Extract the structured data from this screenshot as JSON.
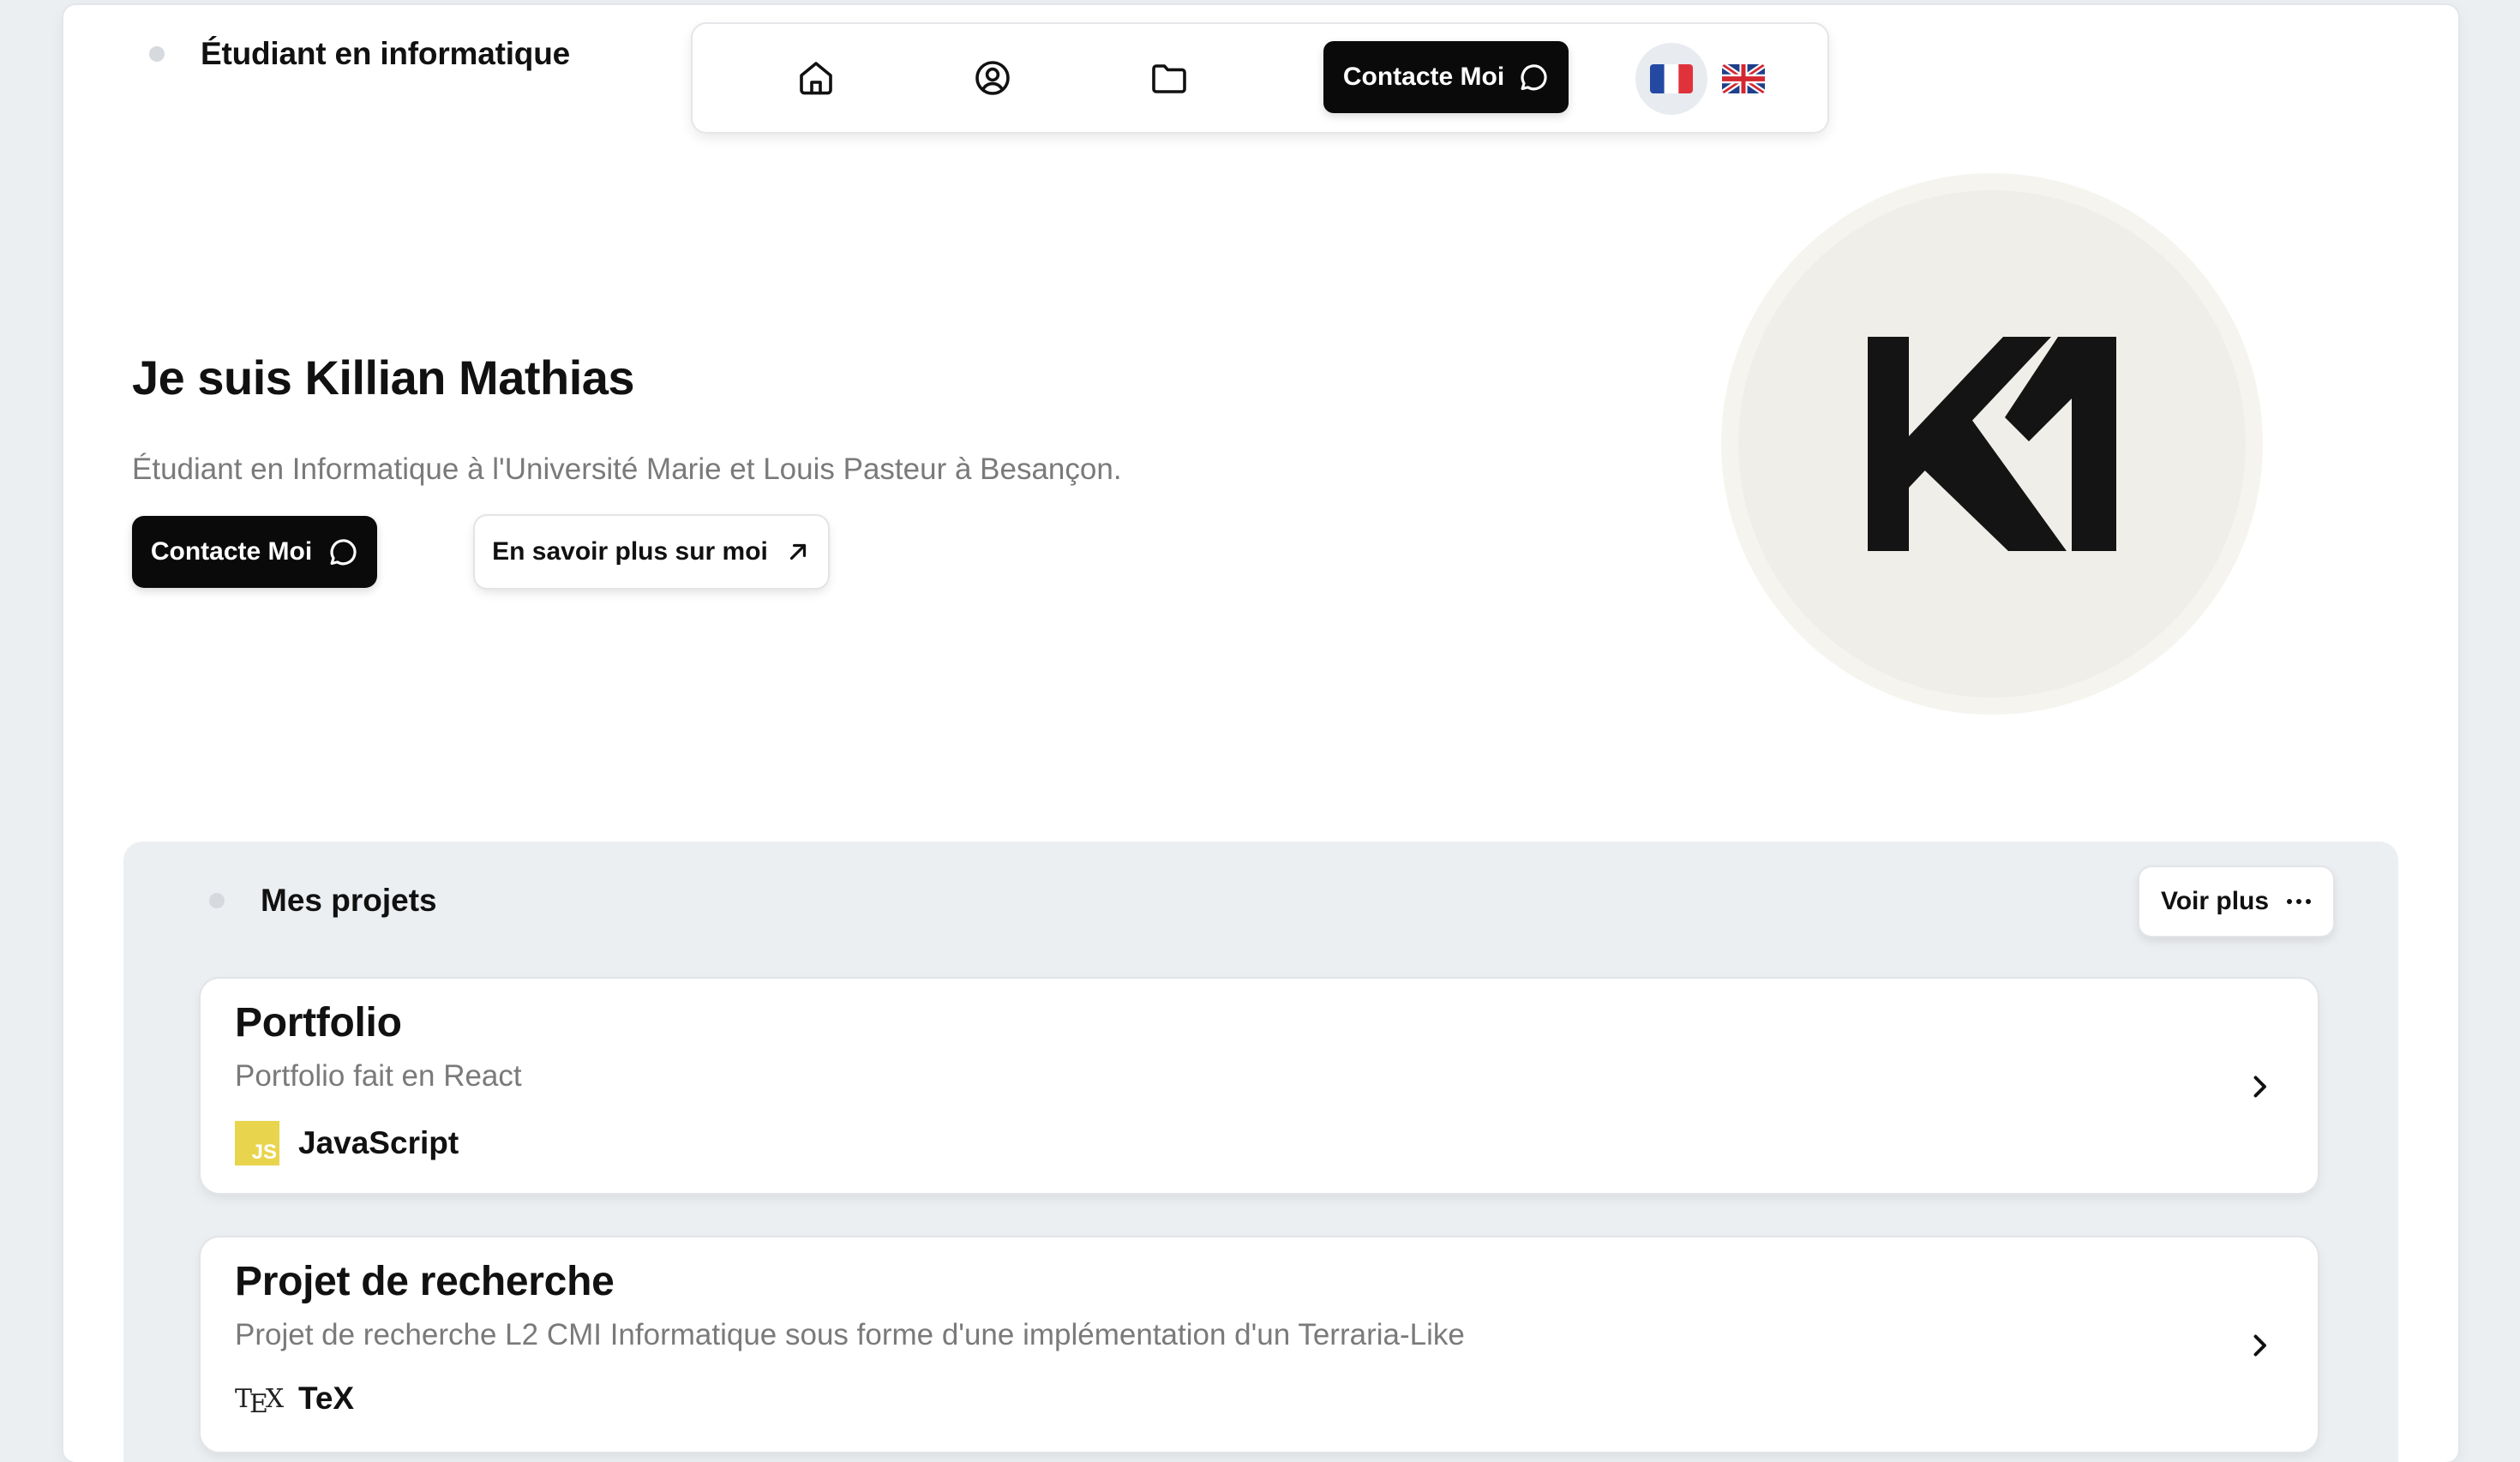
{
  "header": {
    "status_label": "Étudiant en informatique"
  },
  "navbar": {
    "icons": [
      "home-icon",
      "user-circle-icon",
      "folder-icon"
    ],
    "contact_label": "Contacte Moi",
    "languages": [
      {
        "code": "fr",
        "name": "French flag",
        "active": true
      },
      {
        "code": "en",
        "name": "UK flag",
        "active": false
      }
    ]
  },
  "hero": {
    "title": "Je suis Killian Mathias",
    "subtitle": "Étudiant en Informatique à l'Université Marie et Louis Pasteur à Besançon.",
    "contact_button": "Contacte Moi",
    "about_button": "En savoir plus sur moi",
    "logo_text": "KM"
  },
  "projects": {
    "section_label": "Mes projets",
    "more_button": "Voir plus",
    "items": [
      {
        "title": "Portfolio",
        "description": "Portfolio fait en React",
        "tech": "JavaScript",
        "tech_icon": "JS"
      },
      {
        "title": "Projet de recherche",
        "description": "Projet de recherche L2 CMI Informatique sous forme d'une implémentation d'un Terraria-Like",
        "tech": "TeX",
        "tech_icon": "TEX"
      }
    ]
  },
  "colors": {
    "background": "#eceff2",
    "surface": "#ffffff",
    "primary_button": "#0a0a0a",
    "muted_text": "#7a7a7a",
    "avatar_bg": "#f0eee8",
    "js_yellow": "#e9d44d"
  }
}
